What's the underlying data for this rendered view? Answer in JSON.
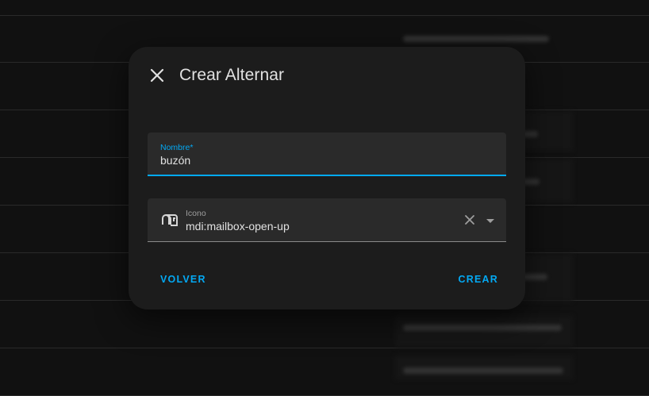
{
  "dialog": {
    "title": "Crear Alternar",
    "name_field": {
      "label": "Nombre*",
      "value": "buzón"
    },
    "icon_field": {
      "label": "Icono",
      "value": "mdi:mailbox-open-up"
    },
    "back_label": "VOLVER",
    "create_label": "CREAR"
  },
  "icons": {
    "close": "close-icon",
    "prefix": "mailbox-open-up-icon",
    "clear": "clear-icon",
    "dropdown": "dropdown-arrow-icon"
  },
  "colors": {
    "accent": "#03a9f4",
    "dialog_bg": "#1c1c1c",
    "field_bg": "#2a2a2a",
    "page_bg": "#111111"
  }
}
